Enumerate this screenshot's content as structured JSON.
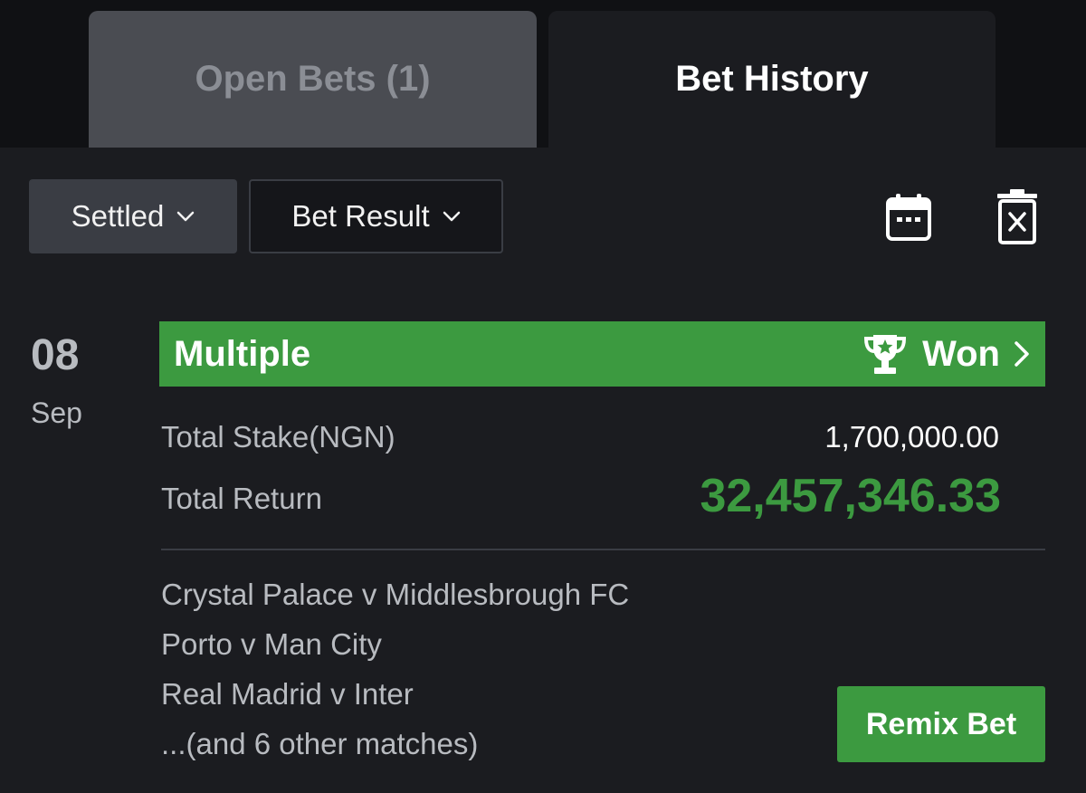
{
  "tabs": [
    {
      "label": "Open Bets (1)",
      "active": false
    },
    {
      "label": "Bet History",
      "active": true
    }
  ],
  "filters": {
    "settled_label": "Settled",
    "result_label": "Bet Result"
  },
  "icons": {
    "calendar": "calendar-icon",
    "delete": "trash-icon",
    "trophy": "trophy-icon",
    "chevron": "chevron-right-icon"
  },
  "bet": {
    "date": {
      "day": "08",
      "month": "Sep"
    },
    "type": "Multiple",
    "status": "Won",
    "stake_label": "Total Stake(NGN)",
    "stake_value": "1,700,000.00",
    "return_label": "Total Return",
    "return_value": "32,457,346.33",
    "matches": [
      "Crystal Palace v Middlesbrough FC",
      "Porto v Man City",
      "Real Madrid v Inter",
      "...(and 6 other matches)"
    ],
    "remix_label": "Remix Bet"
  },
  "colors": {
    "accent_green": "#3c9a40",
    "background": "#1b1c20",
    "muted_text": "#b8bbc0"
  }
}
